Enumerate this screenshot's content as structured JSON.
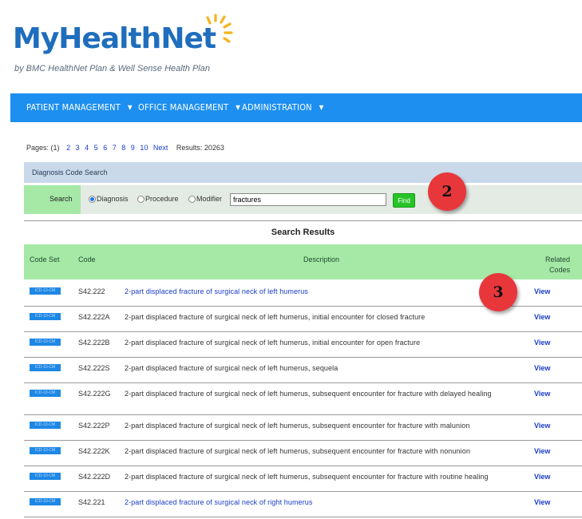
{
  "brand": {
    "logo_text_a": "MyHealth",
    "logo_text_b": "Net",
    "tagline": "by BMC HealthNet Plan & Well Sense Health Plan"
  },
  "nav": {
    "items": [
      {
        "label": "PATIENT MANAGEMENT",
        "caret": "▼"
      },
      {
        "label": "OFFICE MANAGEMENT",
        "caret": "▼"
      },
      {
        "label": "ADMINISTRATION",
        "caret": "▼"
      }
    ]
  },
  "pagination": {
    "prefix": "Pages:",
    "current": "(1)",
    "pages": [
      "2",
      "3",
      "4",
      "5",
      "6",
      "7",
      "8",
      "9",
      "10"
    ],
    "next": "Next",
    "results_label": "Results: 20263"
  },
  "search_section": {
    "title": "Diagnosis Code Search",
    "label": "Search",
    "options": [
      "Diagnosis",
      "Procedure",
      "Modifier"
    ],
    "selected": "Diagnosis",
    "query": "fractures",
    "find_label": "Find"
  },
  "callouts": {
    "two": "2",
    "three": "3"
  },
  "results": {
    "title": "Search Results",
    "columns": {
      "code_set": "Code Set",
      "code": "Code",
      "description": "Description",
      "related_1": "Related",
      "related_2": "Codes"
    },
    "chip_label": "ICD-10-CM",
    "view_label": "View",
    "rows": [
      {
        "code": "S42.222",
        "desc": "2-part displaced fracture of surgical neck of left humerus",
        "link": true
      },
      {
        "code": "S42.222A",
        "desc": "2-part displaced fracture of surgical neck of left humerus, initial encounter for closed fracture",
        "link": false
      },
      {
        "code": "S42.222B",
        "desc": "2-part displaced fracture of surgical neck of left humerus, initial encounter for open fracture",
        "link": false
      },
      {
        "code": "S42.222S",
        "desc": "2-part displaced fracture of surgical neck of left humerus, sequela",
        "link": false
      },
      {
        "code": "S42.222G",
        "desc": "2-part displaced fracture of surgical neck of left humerus, subsequent encounter for fracture with delayed healing",
        "link": false
      },
      {
        "code": "S42.222P",
        "desc": "2-part displaced fracture of surgical neck of left humerus, subsequent encounter for fracture with malunion",
        "link": false
      },
      {
        "code": "S42.222K",
        "desc": "2-part displaced fracture of surgical neck of left humerus, subsequent encounter for fracture with nonunion",
        "link": false
      },
      {
        "code": "S42.222D",
        "desc": "2-part displaced fracture of surgical neck of left humerus, subsequent encounter for fracture with routine healing",
        "link": false
      },
      {
        "code": "S42.221",
        "desc": "2-part displaced fracture of surgical neck of right humerus",
        "link": true
      }
    ]
  },
  "colors": {
    "nav_bg": "#1d8ff0",
    "header_green": "#a6e8a6",
    "link_blue": "#1a3cc7",
    "badge_red": "#e8373b",
    "find_green": "#27c427"
  }
}
